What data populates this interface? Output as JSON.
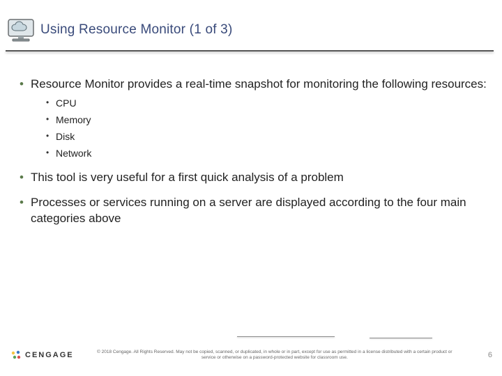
{
  "header": {
    "title": "Using Resource Monitor (1 of 3)"
  },
  "bullets": {
    "b1_0": "Resource Monitor provides a real-time snapshot for monitoring the following resources:",
    "sub": {
      "s0": "CPU",
      "s1": "Memory",
      "s2": "Disk",
      "s3": "Network"
    },
    "b1_1": "This tool is very useful for a first quick analysis of a problem",
    "b1_2": "Processes or services running on a server are displayed according to the four main categories above"
  },
  "footer": {
    "brand": "CENGAGE",
    "copyright": "© 2018 Cengage. All Rights Reserved. May not be copied, scanned, or duplicated, in whole or in part, except for use as permitted in a license distributed with a certain product or service or otherwise on a password-protected website for classroom use.",
    "page": "6"
  }
}
